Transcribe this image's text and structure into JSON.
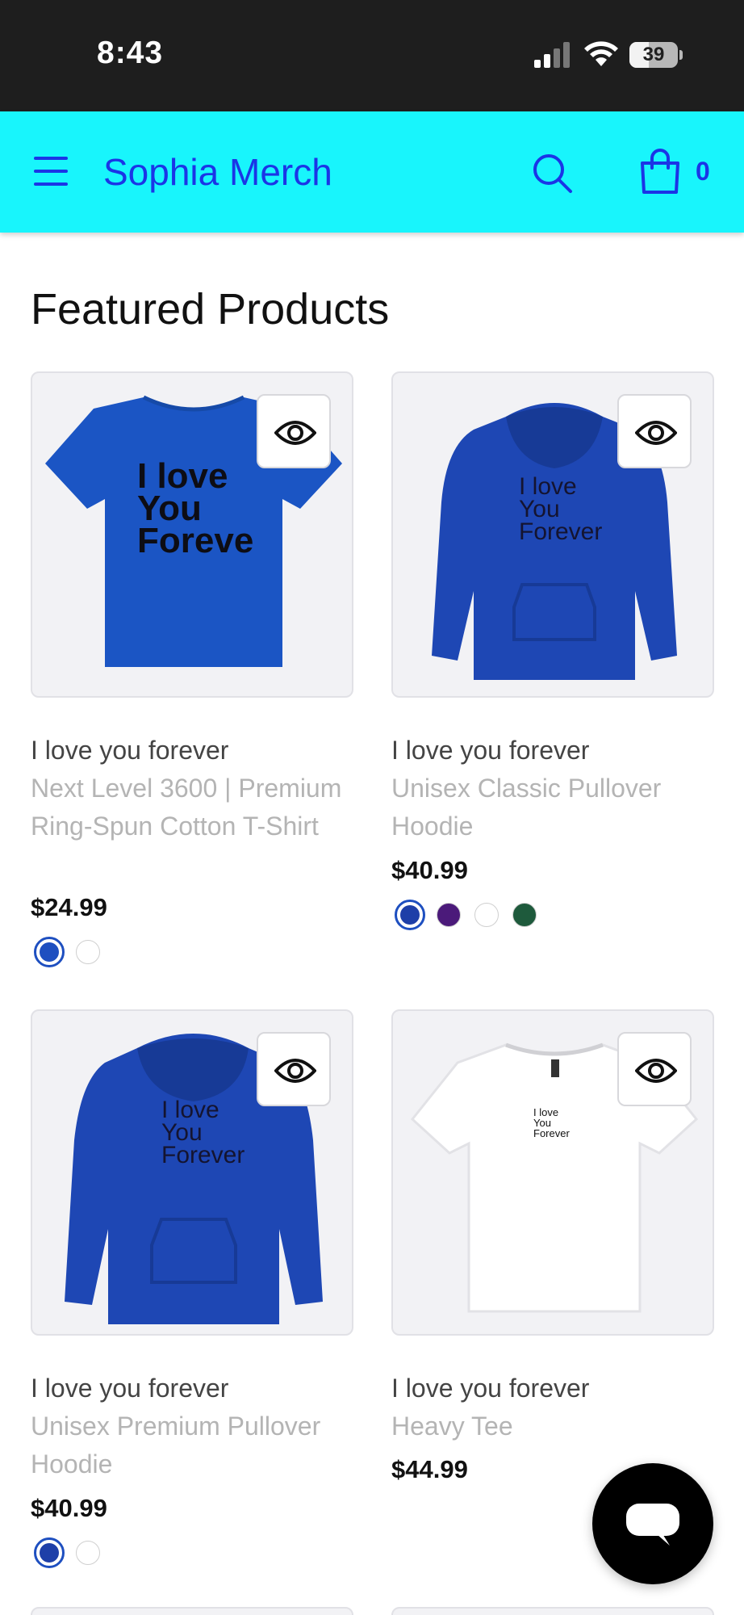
{
  "status_bar": {
    "time": "8:43",
    "battery": "39"
  },
  "header": {
    "store_name": "Sophia Merch",
    "cart_count": "0"
  },
  "section_title": "Featured Products",
  "products": [
    {
      "title": "I love you forever",
      "subtitle": "Next Level 3600 | Premium Ring-Spun Cotton T-Shirt",
      "price": "$24.99",
      "image": "blue-tshirt",
      "print_text": [
        "I love",
        "You",
        "Foreve"
      ],
      "swatches": [
        "#1e4fc0",
        "#ffffff"
      ],
      "selected_swatch": 0
    },
    {
      "title": "I love you forever",
      "subtitle": "Unisex Classic Pullover Hoodie",
      "price": "$40.99",
      "image": "blue-hoodie",
      "print_text": [
        "I love",
        "You",
        "Forever"
      ],
      "swatches": [
        "#1e3fa8",
        "#4b1a7a",
        "#ffffff",
        "#1e5a3c"
      ],
      "selected_swatch": 0
    },
    {
      "title": "I love you forever",
      "subtitle": "Unisex Premium Pullover Hoodie",
      "price": "$40.99",
      "image": "blue-hoodie",
      "print_text": [
        "I love",
        "You",
        "Forever"
      ],
      "swatches": [
        "#1e3fa8",
        "#ffffff"
      ],
      "selected_swatch": 0
    },
    {
      "title": "I love you forever",
      "subtitle": "Heavy Tee",
      "price": "$44.99",
      "image": "white-tshirt",
      "print_text": [
        "I love",
        "You",
        "Forever"
      ],
      "swatches": [],
      "selected_swatch": -1
    }
  ],
  "colors": {
    "header_bg": "#18f5fc",
    "brand_blue": "#1b35e6",
    "status_bg": "#1e1e1e"
  },
  "icons": [
    "menu-icon",
    "search-icon",
    "shopping-bag-icon",
    "eye-icon",
    "chat-icon"
  ]
}
